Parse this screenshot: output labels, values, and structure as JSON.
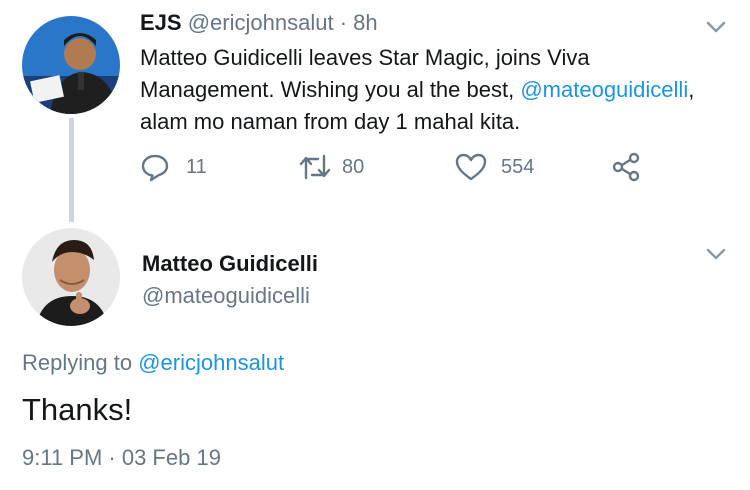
{
  "tweet": {
    "display_name": "EJS",
    "handle": "@ericjohnsalut",
    "separator": "·",
    "time": "8h",
    "text_part1": "Matteo Guidicelli leaves Star Magic, joins Viva Management. Wishing you al the best,",
    "mention": "@mateoguidicelli",
    "text_part1_end": ",",
    "text_part2": "alam mo naman from day 1 mahal kita.",
    "actions": {
      "reply_count": "11",
      "retweet_count": "80",
      "like_count": "554"
    }
  },
  "reply": {
    "display_name": "Matteo Guidicelli",
    "handle": "@mateoguidicelli",
    "replying_prefix": "Replying to",
    "replying_to": "@ericjohnsalut",
    "text": "Thanks!",
    "timestamp": "9:11 PM · 03 Feb 19"
  },
  "icons": [
    "chevron-down-icon",
    "reply-icon",
    "retweet-icon",
    "like-icon",
    "share-icon"
  ],
  "colors": {
    "link": "#1b95e0",
    "muted": "#657786",
    "text": "#14171a",
    "line": "#ccd6dd"
  }
}
